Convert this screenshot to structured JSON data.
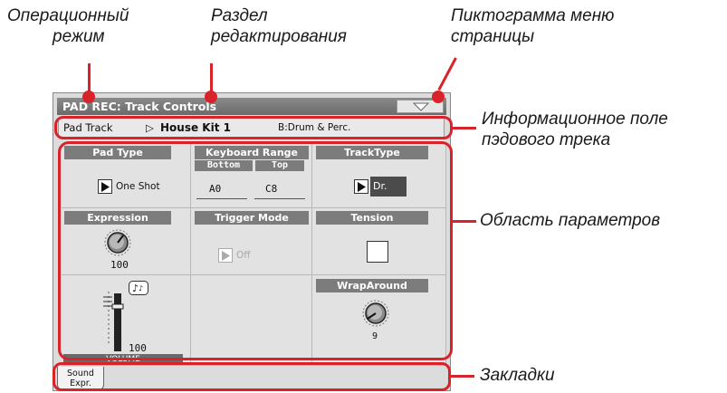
{
  "callouts": {
    "operating_mode_1": "Операционный",
    "operating_mode_2": "режим",
    "edit_section_1": "Раздел",
    "edit_section_2": "редактирования",
    "page_menu_1": "Пиктограмма меню",
    "page_menu_2": "страницы",
    "info_field_1": "Информационное поле",
    "info_field_2": "пэдового трека",
    "param_area": "Область параметров",
    "tabs": "Закладки"
  },
  "screen": {
    "title": "PAD REC: Track Controls",
    "info": {
      "label": "Pad Track",
      "kit_arrow": "▷",
      "kit": "House Kit 1",
      "category": "B:Drum & Perc."
    },
    "params": {
      "pad_type": {
        "header": "Pad Type",
        "value": "One Shot"
      },
      "keyboard_range": {
        "header": "Keyboard Range",
        "bottom_label": "Bottom",
        "top_label": "Top",
        "bottom": "A0",
        "top": "C8"
      },
      "track_type": {
        "header": "TrackType",
        "value": "Dr."
      },
      "expression": {
        "header": "Expression",
        "value": "100"
      },
      "trigger_mode": {
        "header": "Trigger Mode",
        "value": "Off"
      },
      "tension": {
        "header": "Tension"
      },
      "wraparound": {
        "header": "WrapAround",
        "value": "9"
      },
      "volume": {
        "label": "VOLUME",
        "value": "100"
      }
    },
    "tabs": [
      {
        "line1": "Sound",
        "line2": "Expr."
      }
    ]
  },
  "colors": {
    "accent": "#d8232a",
    "header_bg": "#7c7c7c",
    "screen_bg": "#dcdcdc"
  }
}
